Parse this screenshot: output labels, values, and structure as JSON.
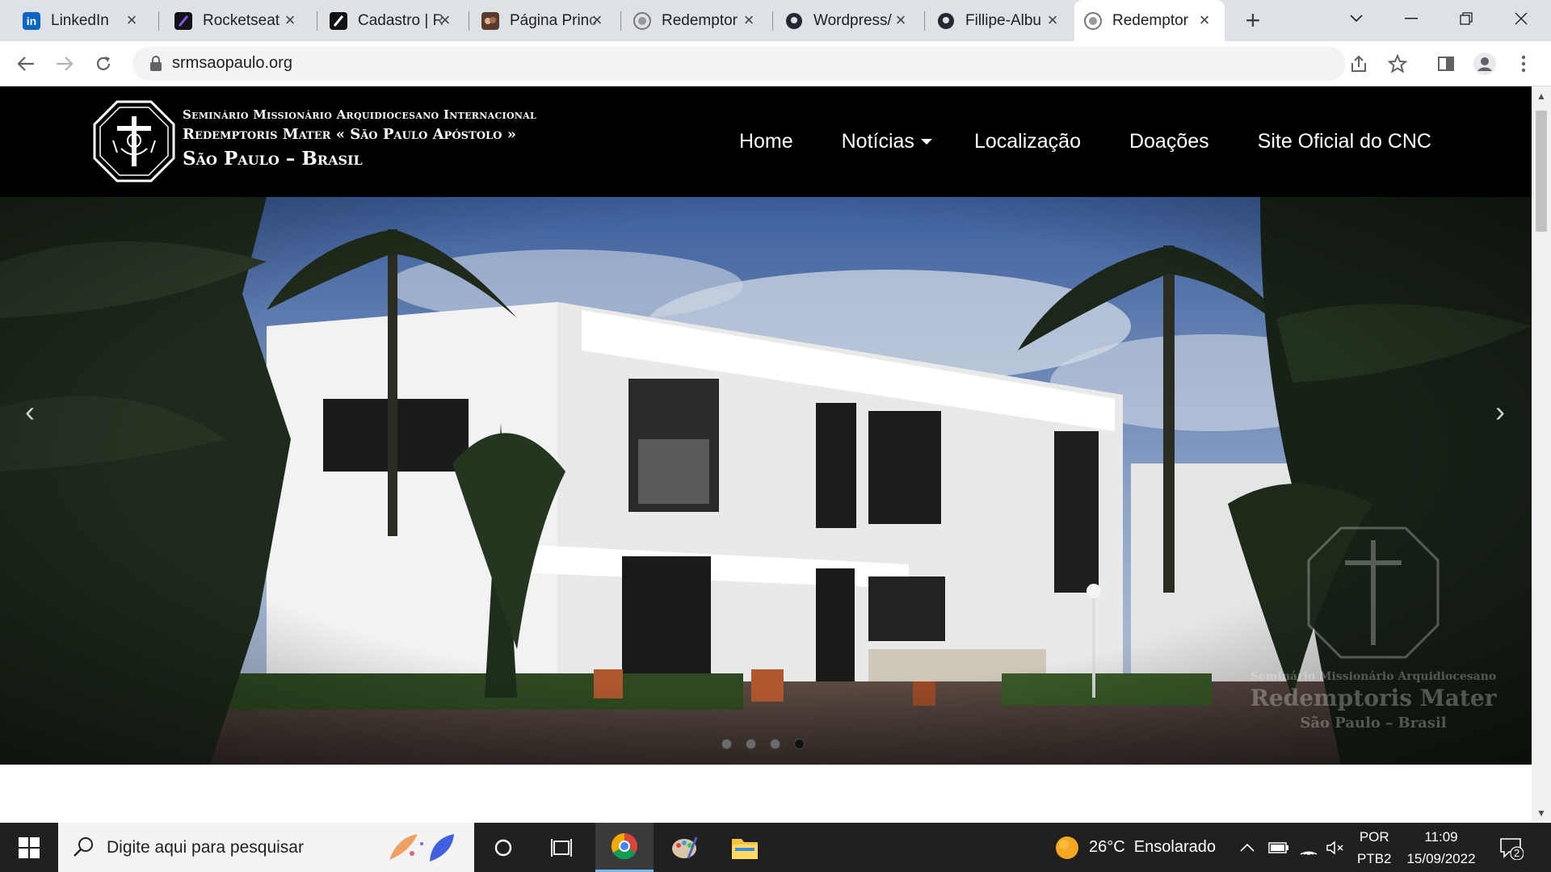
{
  "browser": {
    "tabs": [
      {
        "title": "LinkedIn",
        "icon": "linkedin-icon",
        "color": "#0a66c2"
      },
      {
        "title": "Rocketseat",
        "icon": "rocketseat-icon",
        "color": "#121214"
      },
      {
        "title": "Cadastro | R",
        "icon": "rocketseat-icon",
        "color": "#121214"
      },
      {
        "title": "Página Princ",
        "icon": "painting-icon",
        "color": "#5a3a2a"
      },
      {
        "title": "Redemptor",
        "icon": "seal-icon",
        "color": "#888888"
      },
      {
        "title": "Wordpress/",
        "icon": "github-icon",
        "color": "#24292f"
      },
      {
        "title": "Fillipe-Albu",
        "icon": "github-icon",
        "color": "#24292f"
      },
      {
        "title": "Redemptor",
        "icon": "seal-icon",
        "color": "#888888"
      }
    ],
    "active_tab": 7,
    "url": "srmsaopaulo.org"
  },
  "site": {
    "logo_lines": [
      "Seminário Missionário Arquidiocesano Internacional",
      "Redemptoris Mater « São Paulo Apóstolo »",
      "São Paulo – Brasil"
    ],
    "nav": [
      "Home",
      "Notícias",
      "Localização",
      "Doações",
      "Site Oficial do CNC"
    ],
    "nav_dropdown_index": 1,
    "watermark_lines": [
      "Seminário Missionário Arquidiocesano",
      "Redemptoris Mater",
      "São Paulo – Brasil"
    ],
    "carousel": {
      "slides": 4,
      "active": 3,
      "prev": "‹",
      "next": "›"
    }
  },
  "taskbar": {
    "search_placeholder": "Digite aqui para pesquisar",
    "weather": "26°C  Ensolarado",
    "lang_1": "POR",
    "lang_2": "PTB2",
    "time": "11:09",
    "date": "15/09/2022",
    "notifications": "2"
  },
  "colors": {
    "tabstrip": "#dee1e6",
    "site_header": "#000000",
    "taskbar": "#202020"
  }
}
